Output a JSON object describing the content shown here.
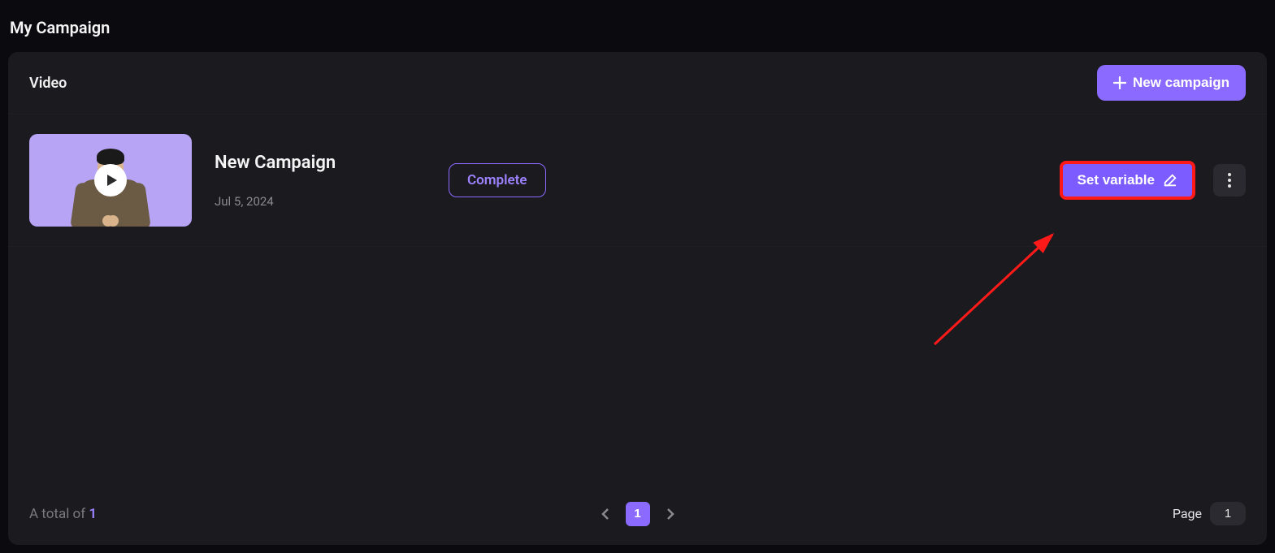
{
  "page": {
    "title": "My Campaign"
  },
  "header": {
    "tab_label": "Video",
    "new_campaign_label": "New campaign"
  },
  "campaigns": [
    {
      "title": "New Campaign",
      "date": "Jul 5, 2024",
      "status": "Complete",
      "set_variable_label": "Set variable"
    }
  ],
  "footer": {
    "total_prefix": "A total of ",
    "total_count": "1",
    "current_page": "1",
    "page_label": "Page",
    "page_input_value": "1"
  }
}
